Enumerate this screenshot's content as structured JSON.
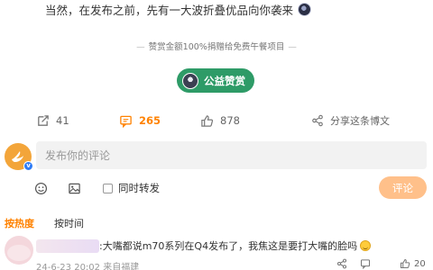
{
  "post": {
    "text": "当然，在发布之前，先有一大波折叠优品向你袭来"
  },
  "reward": {
    "note": "赞赏金额100%捐赠给免费午餐项目",
    "button_label": "公益赞赏"
  },
  "actions": {
    "repost_count": "41",
    "comment_count": "265",
    "like_count": "878",
    "share_label": "分享这条博文"
  },
  "composer": {
    "placeholder": "发布你的评论",
    "sync_label": "同时转发",
    "submit_label": "评论"
  },
  "sort": {
    "hot_label": "按热度",
    "time_label": "按时间"
  },
  "comments": [
    {
      "text": ":大嘴都说m70系列在Q4发布了，我焦这是要打大嘴的脸吗",
      "meta": "24-6-23 20:02 来自福建",
      "like_count": "20"
    }
  ],
  "colors": {
    "accent": "#ff8200",
    "reward_green": "#2e9b67",
    "submit_disabled": "#ffc08a"
  }
}
